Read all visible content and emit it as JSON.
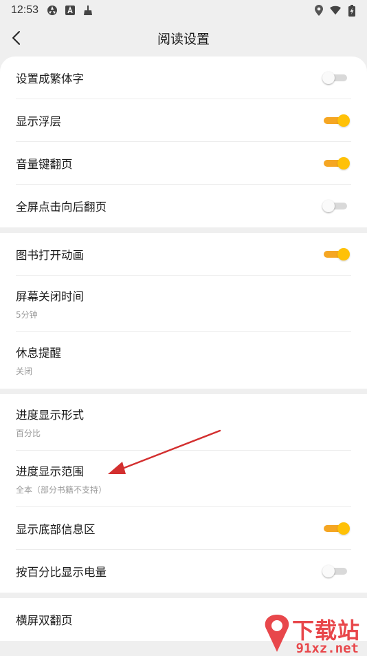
{
  "status_bar": {
    "time": "12:53"
  },
  "app_bar": {
    "title": "阅读设置"
  },
  "groups": [
    {
      "items": [
        {
          "label": "设置成繁体字",
          "toggle": "off"
        },
        {
          "label": "显示浮层",
          "toggle": "on"
        },
        {
          "label": "音量键翻页",
          "toggle": "on"
        },
        {
          "label": "全屏点击向后翻页",
          "toggle": "off"
        }
      ]
    },
    {
      "items": [
        {
          "label": "图书打开动画",
          "toggle": "on"
        },
        {
          "label": "屏幕关闭时间",
          "sub": "5分钟"
        },
        {
          "label": "休息提醒",
          "sub": "关闭"
        }
      ]
    },
    {
      "items": [
        {
          "label": "进度显示形式",
          "sub": "百分比"
        },
        {
          "label": "进度显示范围",
          "sub": "全本（部分书籍不支持）"
        },
        {
          "label": "显示底部信息区",
          "toggle": "on"
        },
        {
          "label": "按百分比显示电量",
          "toggle": "off"
        }
      ]
    },
    {
      "items": [
        {
          "label": "横屏双翻页"
        }
      ]
    }
  ],
  "watermark": {
    "top_text": "下载站",
    "bottom_text": "91xz.net"
  },
  "colors": {
    "accent": "#ffc107",
    "accent_track": "#f5a623",
    "annotation_arrow": "#d32f2f",
    "watermark": "#e8474b"
  }
}
